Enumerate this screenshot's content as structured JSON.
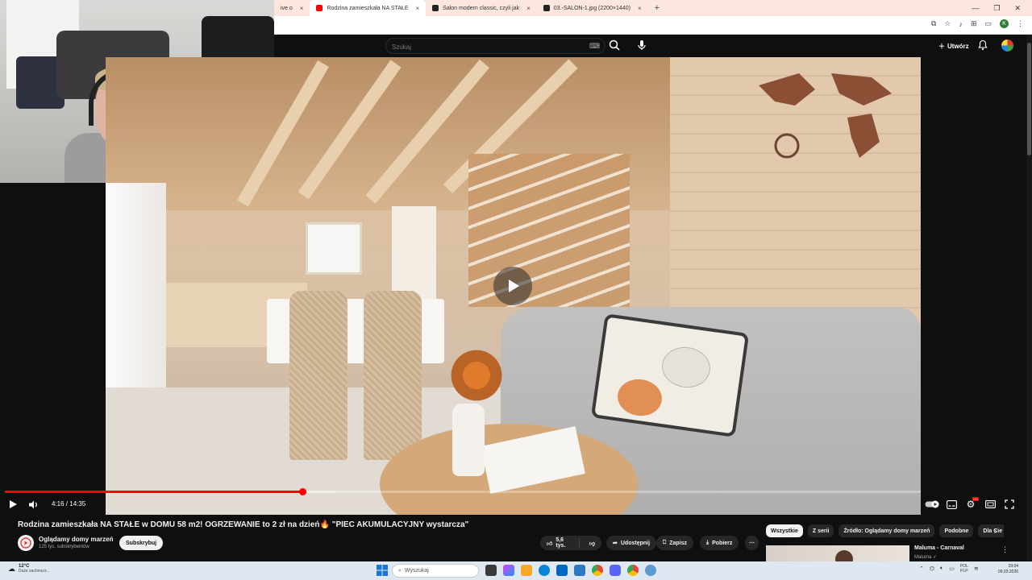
{
  "browser": {
    "tabs": [
      {
        "label": "ive o",
        "active": false
      },
      {
        "label": "Rodzina zamieszkała NA STAŁE",
        "active": true,
        "favicon_color": "#ff0000"
      },
      {
        "label": "Salon modern classic, czyli jak",
        "active": false,
        "favicon_color": "#222222"
      },
      {
        "label": "03.-SALON-1.jpg (2200×1440)",
        "active": false,
        "favicon_color": "#222222"
      }
    ],
    "new_tab_symbol": "+",
    "close_symbol": "×",
    "profile_initial": "K"
  },
  "youtube": {
    "search_placeholder": "Szukaj",
    "create_label": "Utwórz"
  },
  "player": {
    "time_display": "4:16 / 14:35",
    "progress_fraction": 0.325,
    "buffer_fraction": 0.36,
    "hd_label": "HD"
  },
  "video": {
    "title": "Rodzina zamieszkała NA STAŁE w DOMU 58 m2! OGRZEWANIE to 2 zł na dzień🔥 \"PIEC AKUMULACYJNY wystarcza\"",
    "channel_name": "Oglądamy domy marzeń",
    "subscribers": "125 tys. subskrybentów",
    "subscribe_label": "Subskrybuj",
    "likes": "5,6 tys.",
    "share_label": "Udostępnij",
    "save_label": "Zapisz",
    "download_label": "Pobierz",
    "more_label": "⋯"
  },
  "sidebar": {
    "chips": [
      "Wszystkie",
      "Z serii",
      "Źródło: Oglądamy domy marzeń",
      "Podobne",
      "Dla Cie"
    ],
    "recommendation": {
      "title": "Maluma - Carnaval",
      "channel": "Maluma ✓"
    }
  },
  "taskbar": {
    "weather_temp": "12°C",
    "weather_desc": "Duże zachmurz...",
    "search_placeholder": "Wyszukaj",
    "lang_line1": "POL",
    "lang_line2": "PLP",
    "time": "19:04",
    "date": "09.03.2026"
  },
  "colors": {
    "yt_background": "#0f0f0f",
    "progress_red": "#ff0000",
    "tabstrip_bg": "#fde6de",
    "taskbar_bg": "#dfe8f0"
  }
}
